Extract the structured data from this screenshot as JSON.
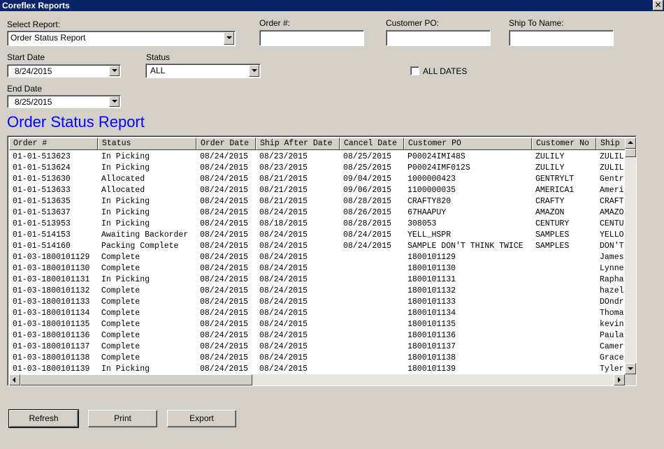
{
  "window": {
    "title": "Coreflex Reports",
    "close_glyph": "✕"
  },
  "filters": {
    "select_report_label": "Select Report:",
    "select_report_value": "Order Status Report",
    "order_no_label": "Order #:",
    "order_no_value": "",
    "customer_po_label": "Customer PO:",
    "customer_po_value": "",
    "ship_to_label": "Ship To Name:",
    "ship_to_value": "",
    "start_date_label": "Start Date",
    "start_date_value": "8/24/2015",
    "status_label": "Status",
    "status_value": "ALL",
    "all_dates_label": "ALL DATES",
    "all_dates_checked": false,
    "end_date_label": "End Date",
    "end_date_value": "8/25/2015"
  },
  "report": {
    "title": "Order Status Report",
    "columns": [
      "Order #",
      "Status",
      "Order Date",
      "Ship After Date",
      "Cancel Date",
      "Customer PO",
      "Customer No",
      "Ship"
    ],
    "rows": [
      [
        "01-01-513623",
        "In Picking",
        "08/24/2015",
        "08/23/2015",
        "08/25/2015",
        "P00024IMI48S",
        "ZULILY",
        "ZULIL"
      ],
      [
        "01-01-513624",
        "In Picking",
        "08/24/2015",
        "08/23/2015",
        "08/25/2015",
        "P00024IMF012S",
        "ZULILY",
        "ZULIL"
      ],
      [
        "01-01-513630",
        "Allocated",
        "08/24/2015",
        "08/21/2015",
        "09/04/2015",
        "1000000423",
        "GENTRYLT",
        "Gentr"
      ],
      [
        "01-01-513633",
        "Allocated",
        "08/24/2015",
        "08/21/2015",
        "09/06/2015",
        "1100000035",
        "AMERICA1",
        "Ameri"
      ],
      [
        "01-01-513635",
        "In Picking",
        "08/24/2015",
        "08/21/2015",
        "08/28/2015",
        "CRAFTY820",
        "CRAFTY",
        "CRAFT"
      ],
      [
        "01-01-513637",
        "In Picking",
        "08/24/2015",
        "08/24/2015",
        "08/26/2015",
        "67HAAPUY",
        "AMAZON",
        "AMAZO"
      ],
      [
        "01-01-513953",
        "In Picking",
        "08/24/2015",
        "08/18/2015",
        "08/28/2015",
        "308053",
        "CENTURY",
        "CENTU"
      ],
      [
        "01-01-514153",
        "Awaiting Backorder",
        "08/24/2015",
        "08/24/2015",
        "08/24/2015",
        "YELL_HSPR",
        "SAMPLES",
        "YELLO"
      ],
      [
        "01-01-514160",
        "Packing Complete",
        "08/24/2015",
        "08/24/2015",
        "08/24/2015",
        "SAMPLE DON'T THINK TWICE",
        "SAMPLES",
        "DON'T"
      ],
      [
        "01-03-1800101129",
        "Complete",
        "08/24/2015",
        "08/24/2015",
        "",
        "1800101129",
        "",
        "James"
      ],
      [
        "01-03-1800101130",
        "Complete",
        "08/24/2015",
        "08/24/2015",
        "",
        "1800101130",
        "",
        "Lynne"
      ],
      [
        "01-03-1800101131",
        "In Picking",
        "08/24/2015",
        "08/24/2015",
        "",
        "1800101131",
        "",
        "Rapha"
      ],
      [
        "01-03-1800101132",
        "Complete",
        "08/24/2015",
        "08/24/2015",
        "",
        "1800101132",
        "",
        "hazel"
      ],
      [
        "01-03-1800101133",
        "Complete",
        "08/24/2015",
        "08/24/2015",
        "",
        "1800101133",
        "",
        "DOndr"
      ],
      [
        "01-03-1800101134",
        "Complete",
        "08/24/2015",
        "08/24/2015",
        "",
        "1800101134",
        "",
        "Thoma"
      ],
      [
        "01-03-1800101135",
        "Complete",
        "08/24/2015",
        "08/24/2015",
        "",
        "1800101135",
        "",
        "kevin"
      ],
      [
        "01-03-1800101136",
        "Complete",
        "08/24/2015",
        "08/24/2015",
        "",
        "1800101136",
        "",
        "Paula"
      ],
      [
        "01-03-1800101137",
        "Complete",
        "08/24/2015",
        "08/24/2015",
        "",
        "1800101137",
        "",
        "Camer"
      ],
      [
        "01-03-1800101138",
        "Complete",
        "08/24/2015",
        "08/24/2015",
        "",
        "1800101138",
        "",
        "Grace"
      ],
      [
        "01-03-1800101139",
        "In Picking",
        "08/24/2015",
        "08/24/2015",
        "",
        "1800101139",
        "",
        "Tyler"
      ]
    ]
  },
  "buttons": {
    "refresh": "Refresh",
    "print": "Print",
    "export": "Export"
  },
  "colors": {
    "title_bar": "#0a246a",
    "report_title": "#0000ff",
    "window_bg": "#d4d0c8"
  }
}
